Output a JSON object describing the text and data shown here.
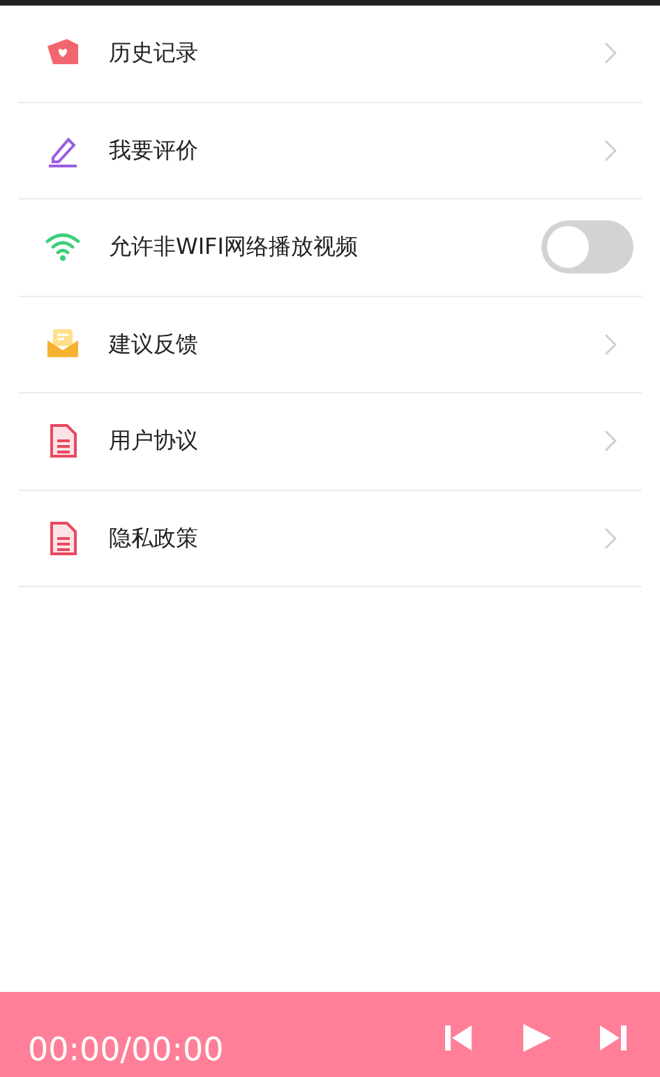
{
  "settings": [
    {
      "kind": "link",
      "label": "历史记录"
    },
    {
      "kind": "link",
      "label": "我要评价"
    },
    {
      "kind": "toggle",
      "label": "允许非WIFI网络播放视频",
      "on": false
    },
    {
      "kind": "link",
      "label": "建议反馈"
    },
    {
      "kind": "link",
      "label": "用户协议"
    },
    {
      "kind": "link",
      "label": "隐私政策"
    }
  ],
  "player": {
    "time": "00:00/00:00"
  }
}
